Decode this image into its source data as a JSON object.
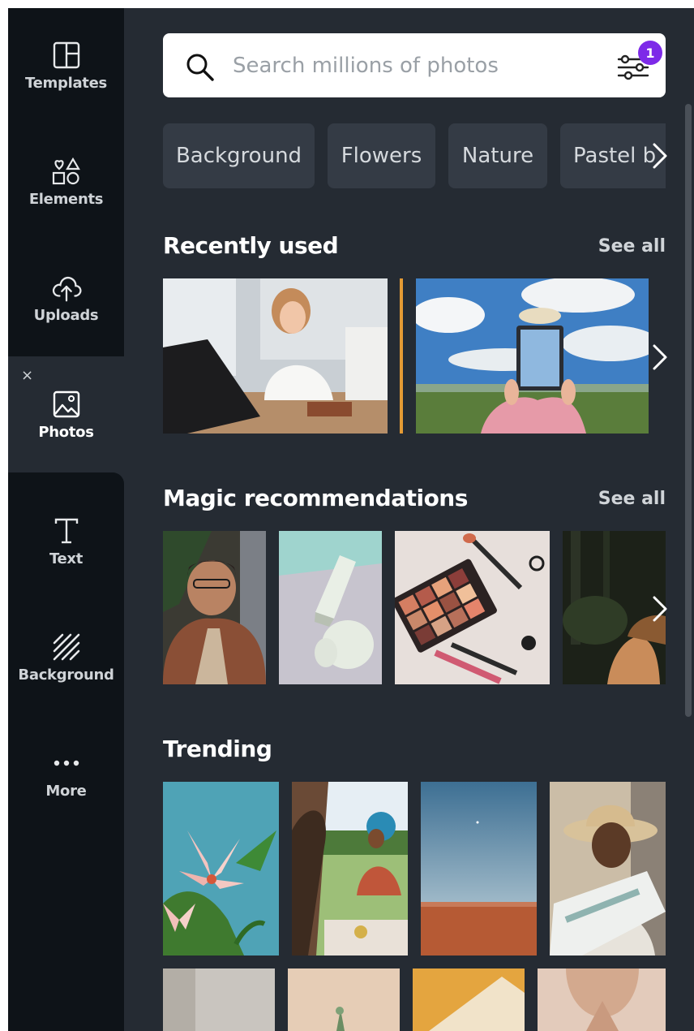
{
  "sidebar": {
    "items": [
      {
        "label": "Templates",
        "icon": "templates-icon"
      },
      {
        "label": "Elements",
        "icon": "elements-icon"
      },
      {
        "label": "Uploads",
        "icon": "cloud-upload-icon"
      },
      {
        "label": "Photos",
        "icon": "image-icon"
      },
      {
        "label": "Text",
        "icon": "text-icon"
      },
      {
        "label": "Background",
        "icon": "background-icon"
      },
      {
        "label": "More",
        "icon": "more-dots-icon"
      }
    ],
    "active": "Photos",
    "close_glyph": "×"
  },
  "search": {
    "placeholder": "Search millions of photos",
    "filter_badge": "1"
  },
  "chips": [
    "Background",
    "Flowers",
    "Nature",
    "Pastel b"
  ],
  "sections": {
    "recently_used": {
      "title": "Recently used",
      "see_all": "See all"
    },
    "magic": {
      "title": "Magic recommendations",
      "see_all": "See all"
    },
    "trending": {
      "title": "Trending"
    }
  },
  "colors": {
    "sidebar_bg": "#0e1318",
    "panel_bg": "#252b33",
    "chip_bg": "#343b45",
    "badge": "#7d2ae8"
  }
}
